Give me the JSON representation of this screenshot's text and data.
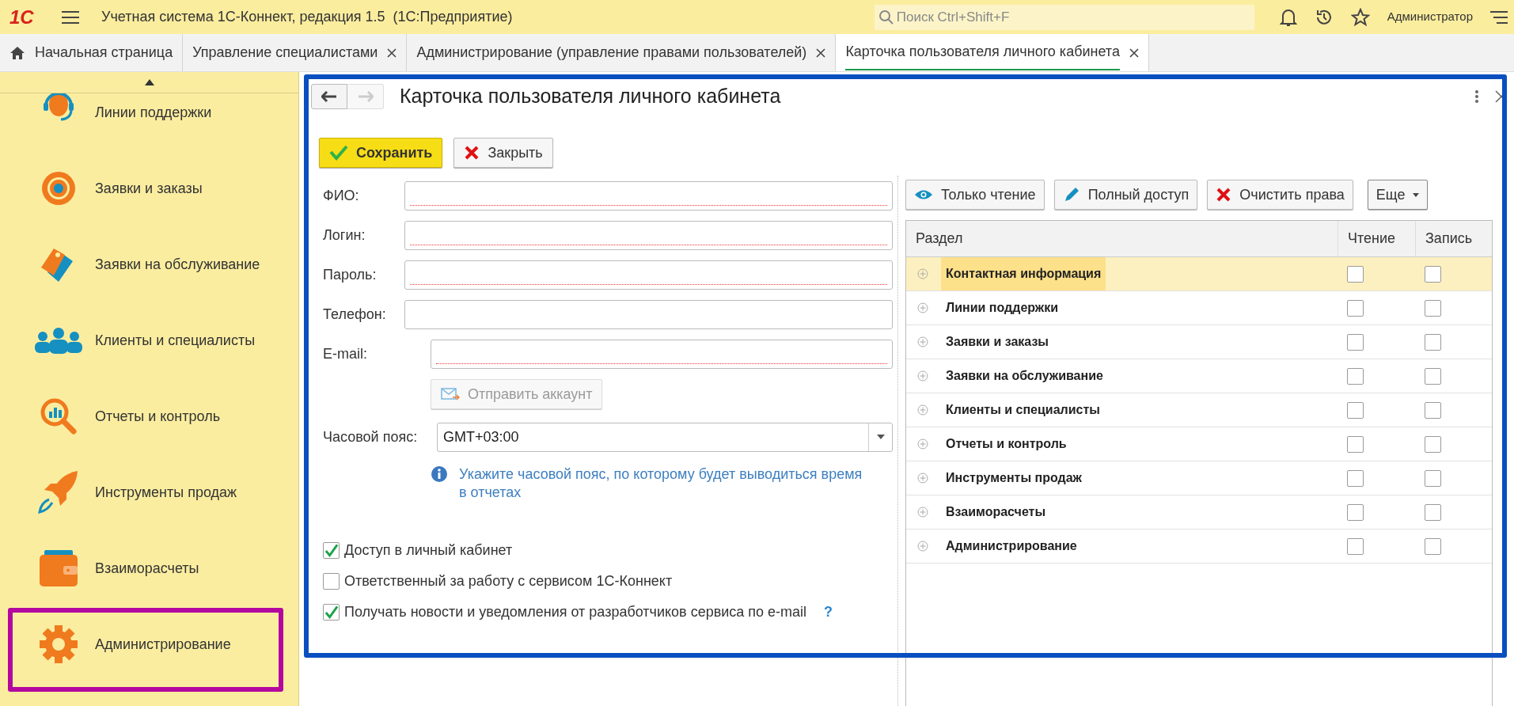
{
  "app_bar": {
    "logo": "1С",
    "title": "Учетная система 1С-Коннект, редакция 1.5  (1С:Предприятие)",
    "search_placeholder": "Поиск Ctrl+Shift+F",
    "user": "Администратор"
  },
  "tabs": [
    {
      "label": "Начальная страница",
      "selected": false,
      "closable": false
    },
    {
      "label": "Управление специалистами",
      "selected": false,
      "closable": true
    },
    {
      "label": "Администрирование (управление правами пользователей)",
      "selected": false,
      "closable": true
    },
    {
      "label": "Карточка пользователя личного кабинета",
      "selected": true,
      "closable": true
    }
  ],
  "sidebar": {
    "items": [
      {
        "label": "Линии поддержки"
      },
      {
        "label": "Заявки и заказы"
      },
      {
        "label": "Заявки на обслуживание"
      },
      {
        "label": "Клиенты и специалисты"
      },
      {
        "label": "Отчеты и контроль"
      },
      {
        "label": "Инструменты продаж"
      },
      {
        "label": "Взаиморасчеты"
      },
      {
        "label": "Администрирование"
      }
    ]
  },
  "form": {
    "title": "Карточка пользователя личного кабинета",
    "actions": [
      {
        "label": "Сохранить",
        "kind": "save"
      },
      {
        "label": "Закрыть",
        "kind": "close"
      }
    ],
    "fields": [
      {
        "label": "ФИО:",
        "required": true,
        "indent": false
      },
      {
        "label": "Логин:",
        "required": true,
        "indent": false
      },
      {
        "label": "Пароль:",
        "required": true,
        "indent": false
      },
      {
        "label": "Телефон:",
        "required": false,
        "indent": false
      },
      {
        "label": "E-mail:",
        "required": true,
        "indent": true
      }
    ],
    "send_button": {
      "label": "Отправить аккаунт",
      "disabled": true
    },
    "timezone": {
      "label": "Часовой пояс:",
      "value": "GMT+03:00"
    },
    "hint": "Укажите часовой пояс, по которому будет выводиться время в отчетах",
    "checkboxes": [
      {
        "label": "Доступ в личный кабинет",
        "checked": true
      },
      {
        "label": "Ответственный за работу с сервисом 1С-Коннект",
        "checked": false
      },
      {
        "label": "Получать новости и уведомления от разработчиков сервиса по e-mail",
        "checked": true
      }
    ],
    "help": "?"
  },
  "rights": {
    "toolbar": [
      {
        "label": "Только чтение",
        "kind": "read"
      },
      {
        "label": "Полный доступ",
        "kind": "edit"
      },
      {
        "label": "Очистить права",
        "kind": "clear"
      },
      {
        "label": "Еще",
        "kind": "more"
      }
    ],
    "columns": [
      "Раздел",
      "Чтение",
      "Запись"
    ],
    "rows": [
      {
        "section": "Контактная информация",
        "read": false,
        "write": false,
        "selected": true
      },
      {
        "section": "Линии поддержки",
        "read": false,
        "write": false,
        "selected": false
      },
      {
        "section": "Заявки и заказы",
        "read": false,
        "write": false,
        "selected": false
      },
      {
        "section": "Заявки на обслуживание",
        "read": false,
        "write": false,
        "selected": false
      },
      {
        "section": "Клиенты и специалисты",
        "read": false,
        "write": false,
        "selected": false
      },
      {
        "section": "Отчеты и контроль",
        "read": false,
        "write": false,
        "selected": false
      },
      {
        "section": "Инструменты продаж",
        "read": false,
        "write": false,
        "selected": false
      },
      {
        "section": "Взаиморасчеты",
        "read": false,
        "write": false,
        "selected": false
      },
      {
        "section": "Администрирование",
        "read": false,
        "write": false,
        "selected": false
      }
    ]
  }
}
